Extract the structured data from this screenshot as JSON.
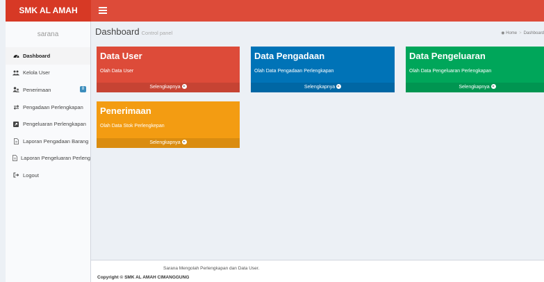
{
  "header": {
    "brand": "SMK AL AMAH"
  },
  "sidebar": {
    "user_panel": "sarana",
    "items": [
      {
        "label": "Dashboard",
        "icon": "dashboard-icon"
      },
      {
        "label": "Kelola User",
        "icon": "users-icon"
      },
      {
        "label": "Penerimaan",
        "icon": "handshake-icon",
        "badge": "8"
      },
      {
        "label": "Pengadaan Perlengkapan",
        "icon": "exchange-icon"
      },
      {
        "label": "Pengeluaran Perlengkapan",
        "icon": "external-link-icon"
      },
      {
        "label": "Laporan Pengadaan Barang",
        "icon": "file-icon"
      },
      {
        "label": "Laporan Pengeluaran Perlengkapan",
        "icon": "file-icon"
      },
      {
        "label": "Logout",
        "icon": "sign-out-icon"
      }
    ]
  },
  "content_header": {
    "title": "Dashboard",
    "subtitle": "Control panel",
    "breadcrumb_home": "Home",
    "breadcrumb_current": "Dashboard"
  },
  "boxes": [
    {
      "title": "Data User",
      "description": "Olah Data User",
      "more": "Selengkapnya",
      "color": "#dd4b39",
      "footer_color": "#c64333"
    },
    {
      "title": "Data Pengadaan",
      "description": "Olah Data Pengadaan Perlengkapan",
      "more": "Selengkapnya",
      "color": "#0073b7",
      "footer_color": "#0067a4"
    },
    {
      "title": "Data Pengeluaran",
      "description": "Olah Data Pengeluaran Perlengkapan",
      "more": "Selengkapnya",
      "color": "#00a65a",
      "footer_color": "#009551"
    },
    {
      "title": "Penerimaan",
      "description": "Olah Data Stok Perlengkepan",
      "more": "Selengkapnya",
      "color": "#f39c12",
      "footer_color": "#da8c10"
    }
  ],
  "footer": {
    "text": "Sarana Mengolah Perlengkapan dan Data User.",
    "copyright": "Copyright © SMK AL AMAH CIMANGGUNG"
  }
}
